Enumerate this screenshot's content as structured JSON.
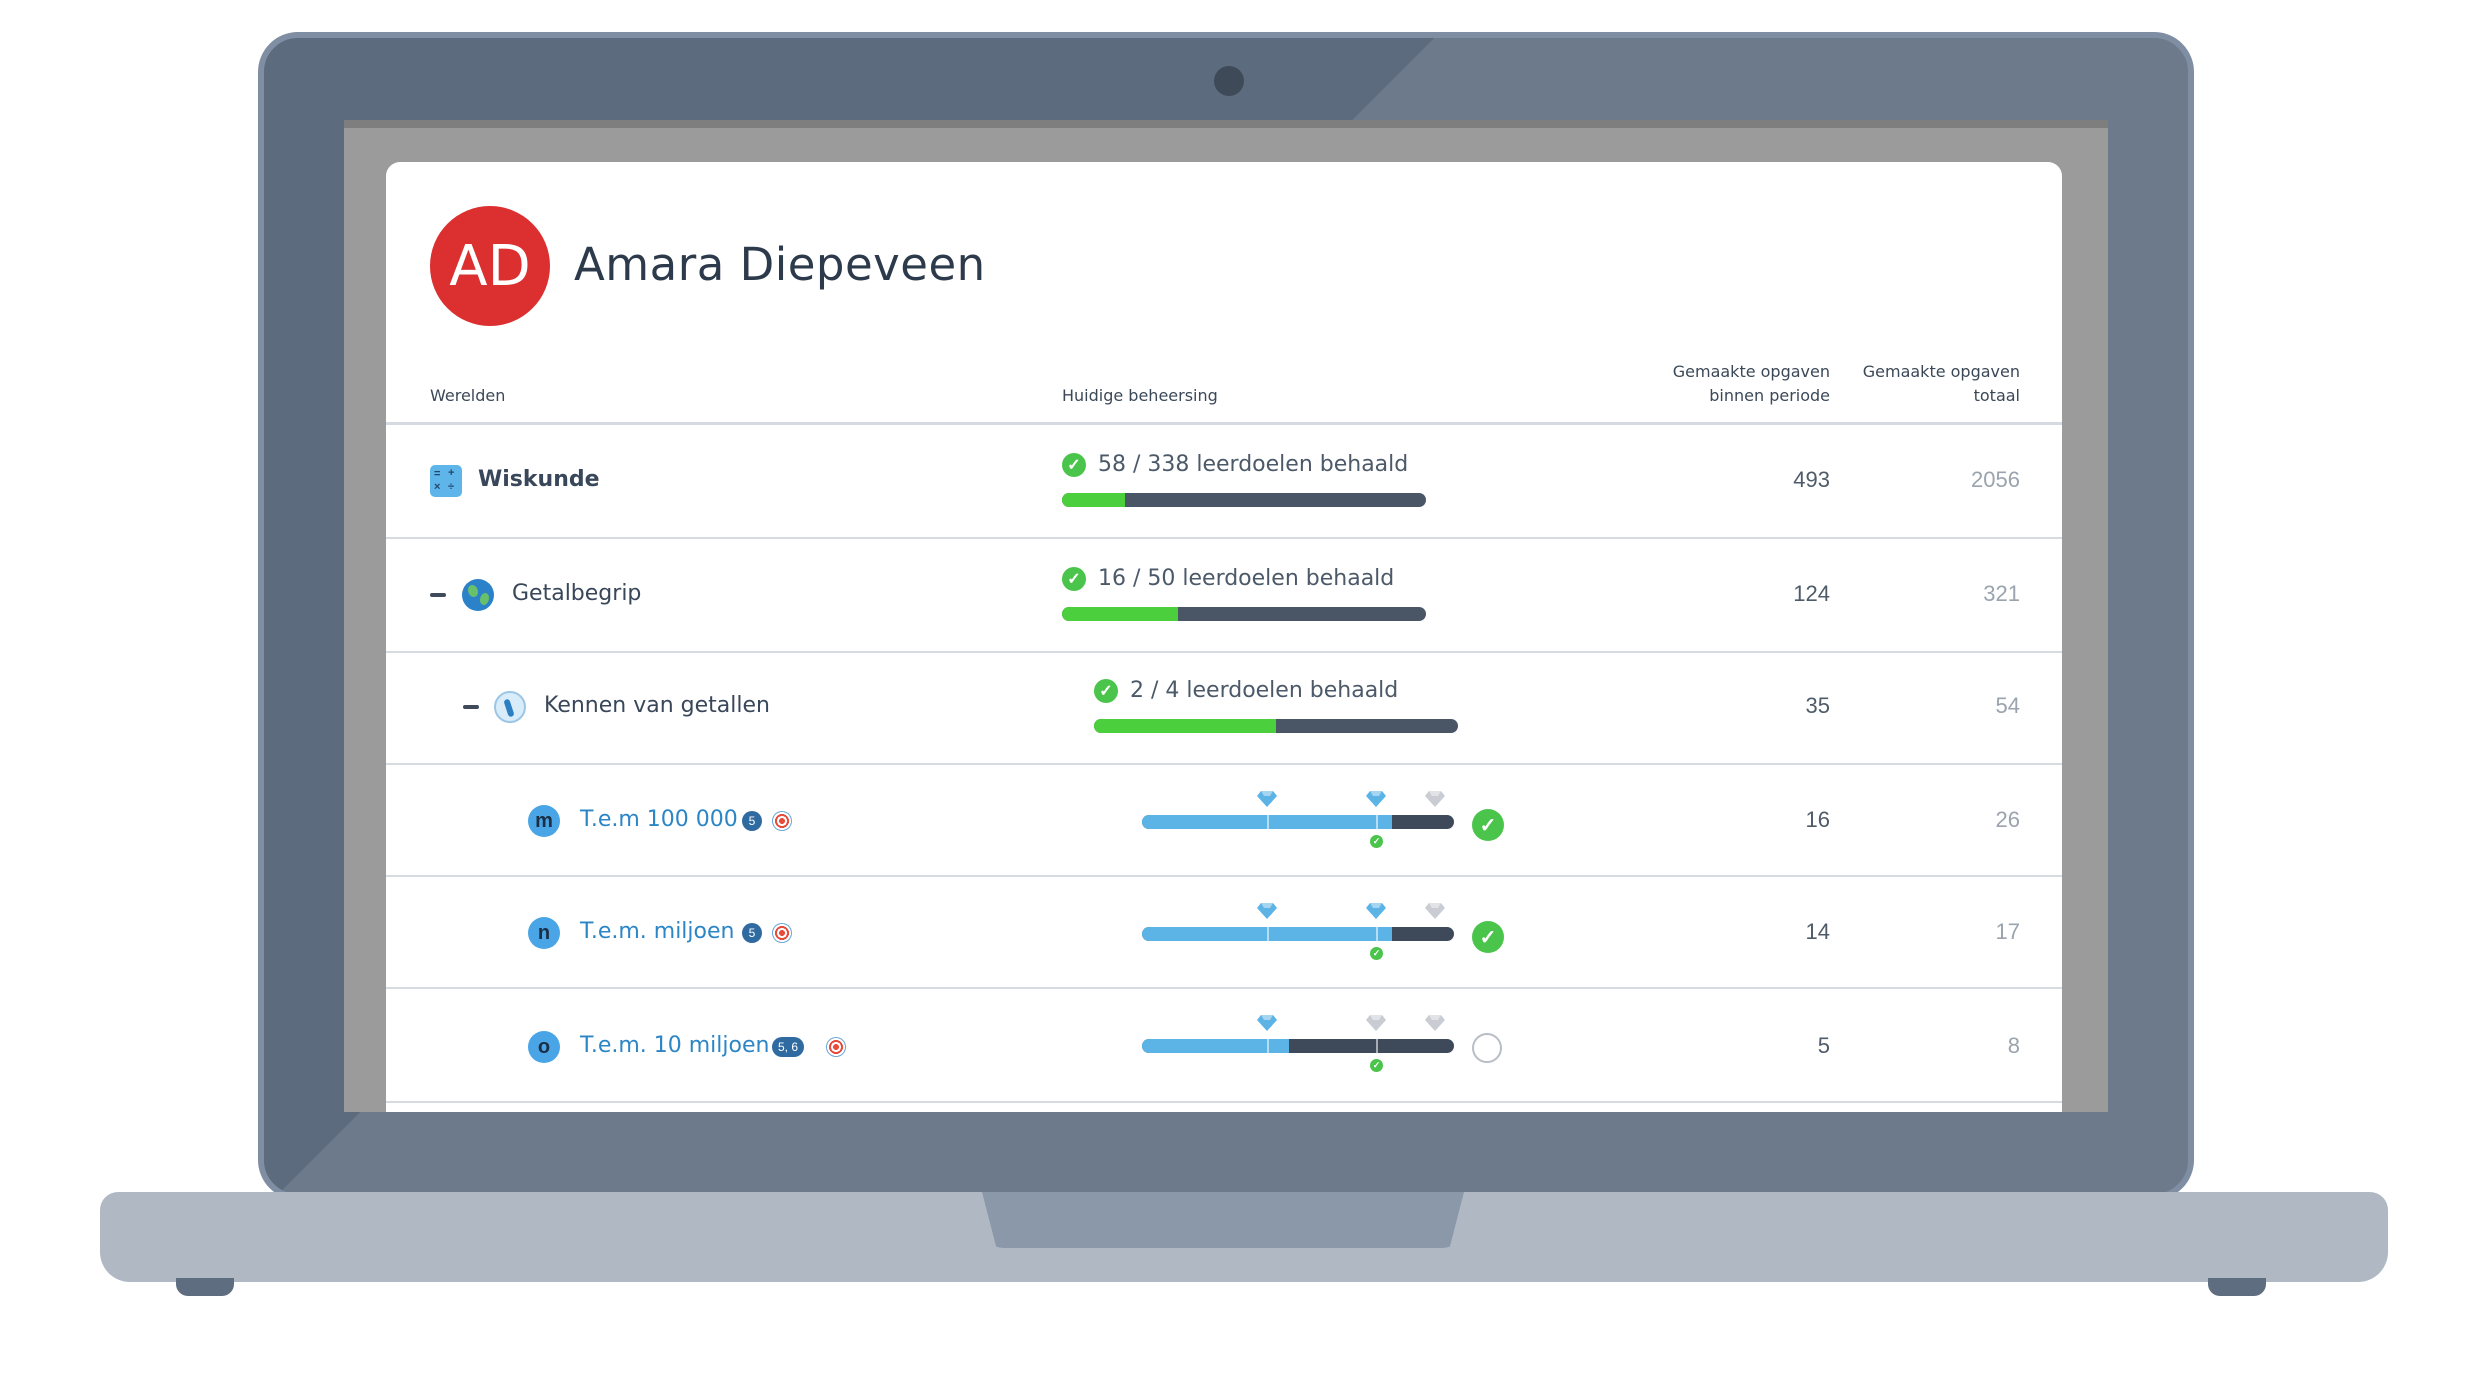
{
  "student": {
    "initials": "AD",
    "name": "Amara Diepeveen"
  },
  "columns": {
    "worlds": "Werelden",
    "mastery": "Huidige beheersing",
    "period_line1": "Gemaakte opgaven",
    "period_line2": "binnen periode",
    "total_line1": "Gemaakte opgaven",
    "total_line2": "totaal"
  },
  "rows": [
    {
      "name": "Wiskunde",
      "progress_text": "58 / 338 leerdoelen behaald",
      "progress": 0.172,
      "period": "493",
      "total": "2056"
    },
    {
      "name": "Getalbegrip",
      "progress_text": "16 / 50 leerdoelen behaald",
      "progress": 0.32,
      "period": "124",
      "total": "321"
    },
    {
      "name": "Kennen van getallen",
      "progress_text": "2 / 4 leerdoelen behaald",
      "progress": 0.5,
      "period": "35",
      "total": "54"
    }
  ],
  "skills": [
    {
      "letter": "m",
      "name": "T.e.m 100 000",
      "level": "5",
      "progress": 0.8,
      "completed": true,
      "period": "16",
      "total": "26"
    },
    {
      "letter": "n",
      "name": "T.e.m. miljoen",
      "level": "5",
      "progress": 0.8,
      "completed": true,
      "period": "14",
      "total": "17"
    },
    {
      "letter": "o",
      "name": "T.e.m. 10 miljoen",
      "level": "5, 6",
      "progress": 0.47,
      "completed": false,
      "period": "5",
      "total": "8"
    }
  ],
  "colors": {
    "avatar": "#dc2f2f",
    "progress_green": "#4ccf3c",
    "skill_blue": "#5bb3e6",
    "link": "#2c86c6"
  }
}
